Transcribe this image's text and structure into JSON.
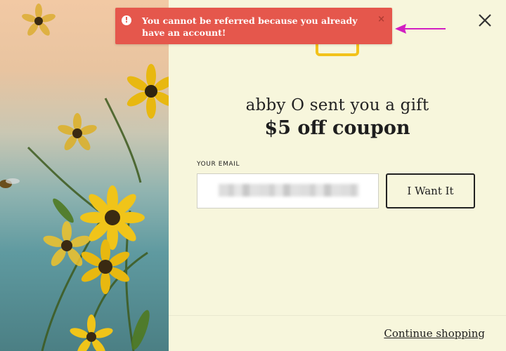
{
  "toast": {
    "message": "You cannot be referred because you already have an account!",
    "close_glyph": "×",
    "alert_glyph": "!",
    "color": "#e5574c"
  },
  "modal": {
    "sender_line": "abby O sent you a gift",
    "offer_line": "$5 off coupon",
    "email_label": "YOUR EMAIL",
    "email_value": "",
    "submit_label": "I Want It",
    "continue_label": "Continue shopping",
    "close_glyph": "×",
    "background_color": "#f7f6dc",
    "accent_color": "#f2c21b"
  },
  "annotation": {
    "arrow_color": "#d21fc2"
  }
}
